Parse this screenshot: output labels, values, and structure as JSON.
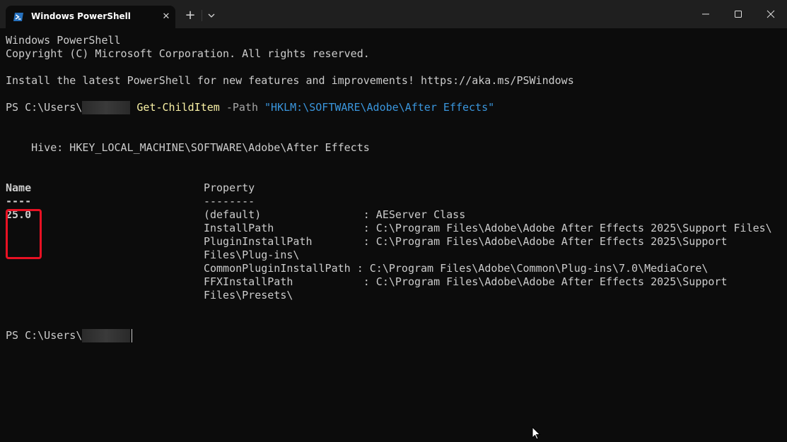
{
  "titlebar": {
    "tab_title": "Windows PowerShell",
    "tab_icon": "powershell-icon",
    "close_tab_icon": "close-icon",
    "new_tab_label": "+",
    "dropdown_icon": "chevron-down-icon",
    "window_controls": [
      "minimize-icon",
      "maximize-icon",
      "close-icon"
    ]
  },
  "terminal": {
    "banner_1": "Windows PowerShell",
    "banner_2": "Copyright (C) Microsoft Corporation. All rights reserved.",
    "install_msg": "Install the latest PowerShell for new features and improvements! https://aka.ms/PSWindows",
    "prompt_prefix": "PS C:\\Users\\",
    "command": "Get-ChildItem",
    "param": "-Path",
    "arg": "\"HKLM:\\SOFTWARE\\Adobe\\After Effects\"",
    "hive": "    Hive: HKEY_LOCAL_MACHINE\\SOFTWARE\\Adobe\\After Effects",
    "headers": {
      "name": "Name",
      "name_underline": "----",
      "property": "Property",
      "property_underline": "--------"
    },
    "name_value": "25.0",
    "properties": [
      "(default)                : AEServer Class",
      "InstallPath              : C:\\Program Files\\Adobe\\Adobe After Effects 2025\\Support Files\\",
      "PluginInstallPath        : C:\\Program Files\\Adobe\\Adobe After Effects 2025\\Support",
      "Files\\Plug-ins\\",
      "CommonPluginInstallPath : C:\\Program Files\\Adobe\\Common\\Plug-ins\\7.0\\MediaCore\\",
      "FFXInstallPath           : C:\\Program Files\\Adobe\\Adobe After Effects 2025\\Support",
      "Files\\Presets\\"
    ],
    "final_prompt": "PS C:\\Users\\"
  },
  "colors": {
    "background": "#0c0c0c",
    "titlebar": "#1f1f1f",
    "text": "#cccccc",
    "command": "#f9f1a5",
    "string": "#3a96dd",
    "highlight": "#e81123"
  }
}
